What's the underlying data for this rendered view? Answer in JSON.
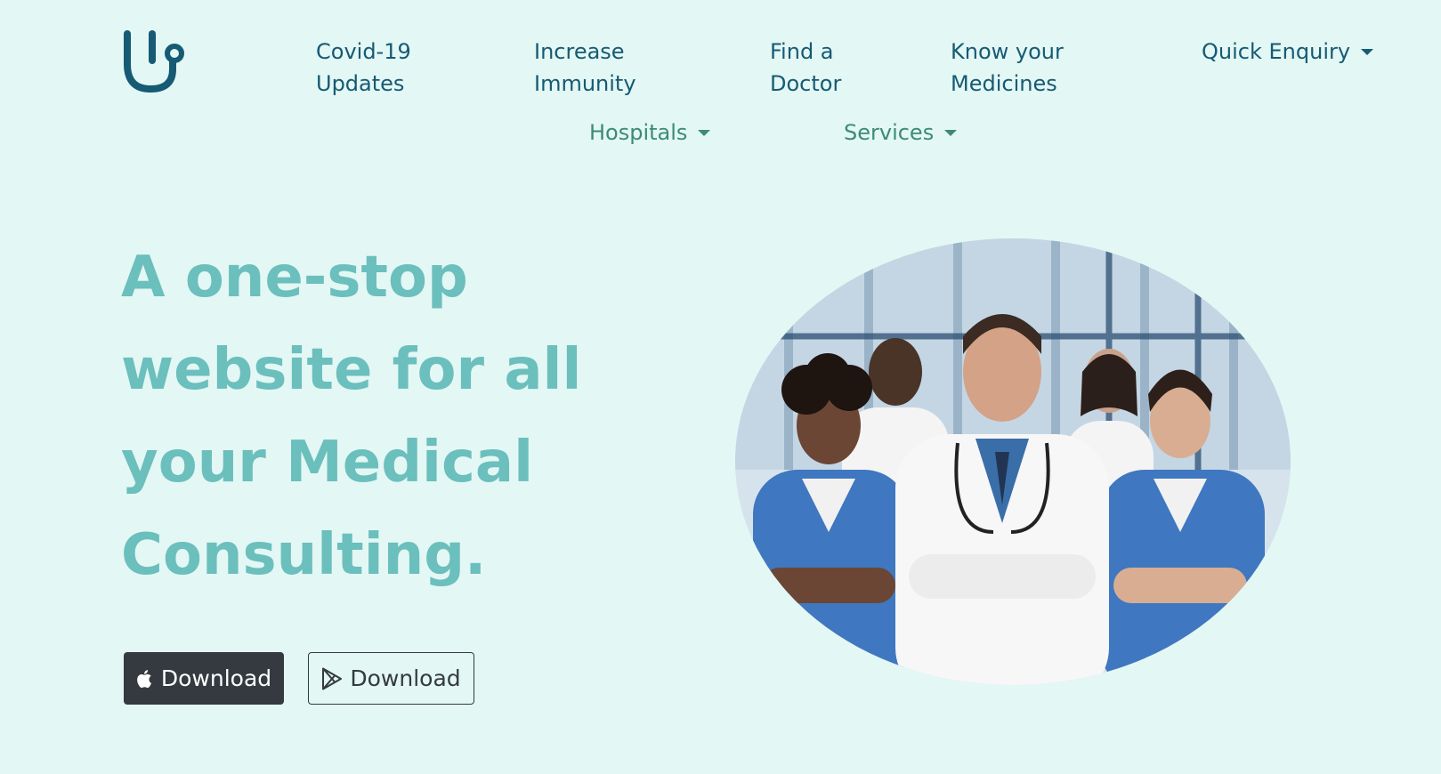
{
  "colors": {
    "background": "#e3f7f4",
    "nav_primary": "#165a74",
    "nav_secondary": "#3d8b75",
    "heading": "#6bbfbd",
    "button_dark": "#343a40"
  },
  "logo": {
    "icon": "stethoscope-icon"
  },
  "nav": {
    "covid": [
      "Covid-19",
      "Updates"
    ],
    "immunity": [
      "Increase",
      "Immunity"
    ],
    "doctor": [
      "Find a",
      "Doctor"
    ],
    "medicines": [
      "Know your",
      "Medicines"
    ],
    "enquiry": "Quick Enquiry",
    "hospitals": "Hospitals",
    "services": "Services"
  },
  "hero": {
    "heading_lines": [
      "A one-stop",
      "website for all",
      "your Medical",
      "Consulting."
    ],
    "buttons": [
      {
        "label": "Download",
        "icon": "apple-icon"
      },
      {
        "label": "Download",
        "icon": "play-store-icon"
      }
    ]
  }
}
